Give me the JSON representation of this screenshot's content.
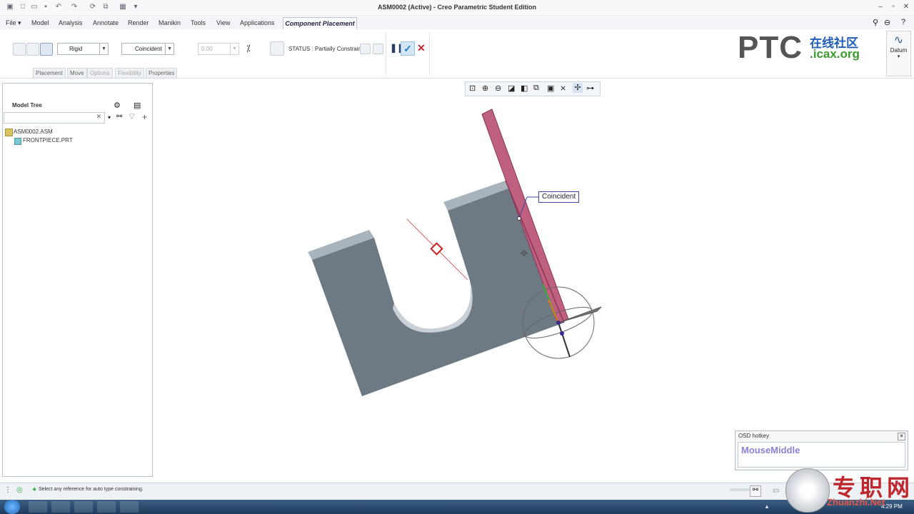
{
  "window": {
    "title": "ASM0002 (Active) - Creo Parametric Student Edition"
  },
  "menu": {
    "file": "File",
    "items": [
      "Model",
      "Analysis",
      "Annotate",
      "Render",
      "Manikin",
      "Tools",
      "View",
      "Applications"
    ],
    "active_tab": "Component Placement"
  },
  "ribbon": {
    "constraint_set": "Rigid",
    "constraint_type": "Coincident",
    "offset_value": "0.00",
    "status": "STATUS : Partially Constrained",
    "subtabs": [
      "Placement",
      "Move",
      "Options",
      "Flexibility",
      "Properties"
    ],
    "datum_label": "Datum"
  },
  "watermark": {
    "ptc": "PTC",
    "cn": "在线社区",
    "site": ".icax.org"
  },
  "model_tree": {
    "title": "Model Tree",
    "items": [
      "ASM0002.ASM",
      "FRONTPIECE.PRT"
    ]
  },
  "graphics": {
    "constraint_label": "Coincident"
  },
  "osd": {
    "title": "OSD hotkey",
    "key": "MouseMiddle"
  },
  "statusbar": {
    "message": "Select any reference for auto type constraining.",
    "clock": "4:29 PM"
  },
  "logo": {
    "cn": "专职网",
    "site": "Zhuanzhi.Net"
  },
  "colors": {
    "part_gray": "#6d7a84",
    "plane_pink": "#c0607f",
    "accent_green": "#2eae3c",
    "cancel_red": "#c0272d"
  }
}
